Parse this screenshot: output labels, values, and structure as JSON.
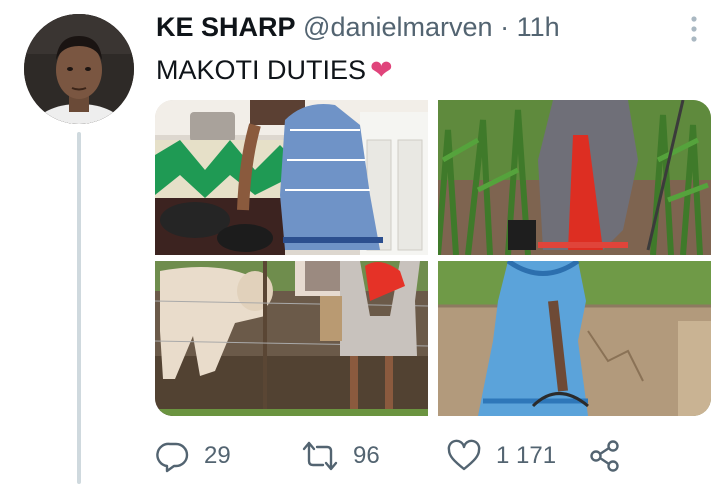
{
  "tweet": {
    "display_name": "KE SHARP",
    "handle": "@danielmarven",
    "separator": "·",
    "time": "11h",
    "text": "MAKOTI DUTIES",
    "emoji": "❤"
  },
  "media": [
    {
      "icon": "photo-cooking"
    },
    {
      "icon": "photo-field"
    },
    {
      "icon": "photo-cow"
    },
    {
      "icon": "photo-well"
    }
  ],
  "actions": {
    "replies": "29",
    "retweets": "96",
    "likes": "1 171"
  },
  "colors": {
    "text": "#0f1419",
    "secondary": "#536471",
    "heart": "#e0447b",
    "thread_line": "#cfd9de"
  }
}
